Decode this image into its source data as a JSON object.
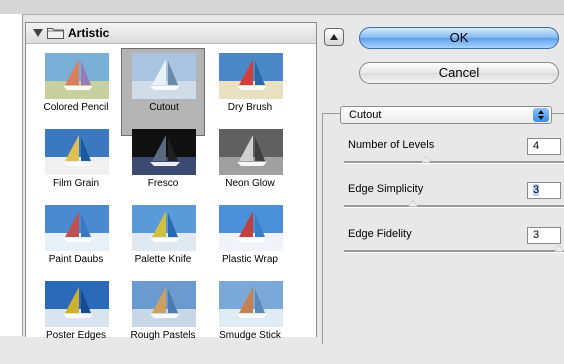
{
  "gallery": {
    "category": "Artistic",
    "filters": [
      {
        "label": "Colored Pencil",
        "icon": "colored-pencil-thumbnail"
      },
      {
        "label": "Cutout",
        "icon": "cutout-thumbnail",
        "selected": true
      },
      {
        "label": "Dry Brush",
        "icon": "dry-brush-thumbnail"
      },
      {
        "label": "Film Grain",
        "icon": "film-grain-thumbnail"
      },
      {
        "label": "Fresco",
        "icon": "fresco-thumbnail"
      },
      {
        "label": "Neon Glow",
        "icon": "neon-glow-thumbnail"
      },
      {
        "label": "Paint Daubs",
        "icon": "paint-daubs-thumbnail"
      },
      {
        "label": "Palette Knife",
        "icon": "palette-knife-thumbnail"
      },
      {
        "label": "Plastic Wrap",
        "icon": "plastic-wrap-thumbnail"
      },
      {
        "label": "Poster Edges",
        "icon": "poster-edges-thumbnail"
      },
      {
        "label": "Rough Pastels",
        "icon": "rough-pastels-thumbnail"
      },
      {
        "label": "Smudge Stick",
        "icon": "smudge-stick-thumbnail"
      }
    ]
  },
  "buttons": {
    "ok": "OK",
    "cancel": "Cancel"
  },
  "settings": {
    "filter": "Cutout",
    "params": [
      {
        "label": "Number of Levels",
        "value": "4",
        "level": 0.36
      },
      {
        "label": "Edge Simplicity",
        "value": "3",
        "level": 0.3
      },
      {
        "label": "Edge Fidelity",
        "value": "3",
        "level": 1.0
      }
    ]
  },
  "colors": {
    "accent": "#5ea0ea",
    "selection": "#b4b4b4"
  }
}
